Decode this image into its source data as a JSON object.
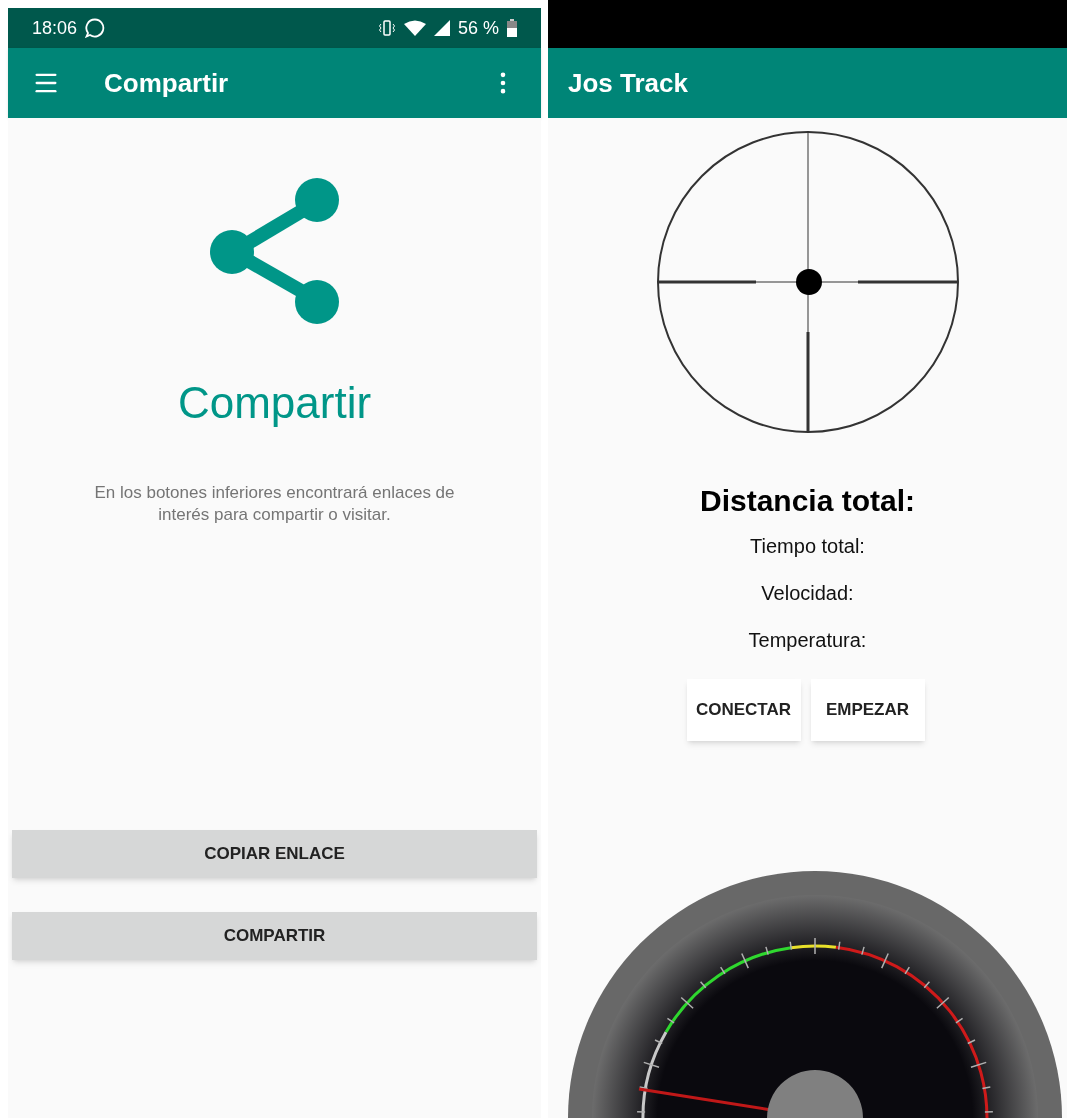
{
  "left_screen": {
    "status_bar": {
      "time": "18:06",
      "battery": "56 %"
    },
    "app_bar": {
      "title": "Compartir"
    },
    "heading": "Compartir",
    "description": "En los botones inferiores encontrará enlaces de interés para compartir o visitar.",
    "buttons": [
      "COPIAR ENLACE",
      "COMPARTIR"
    ]
  },
  "right_screen": {
    "app_bar": {
      "title": "Jos Track"
    },
    "distance_label": "Distancia total:",
    "stats": [
      "Tiempo total:",
      "Velocidad:",
      "Temperatura:"
    ],
    "buttons": [
      "CONECTAR",
      "EMPEZAR"
    ]
  }
}
